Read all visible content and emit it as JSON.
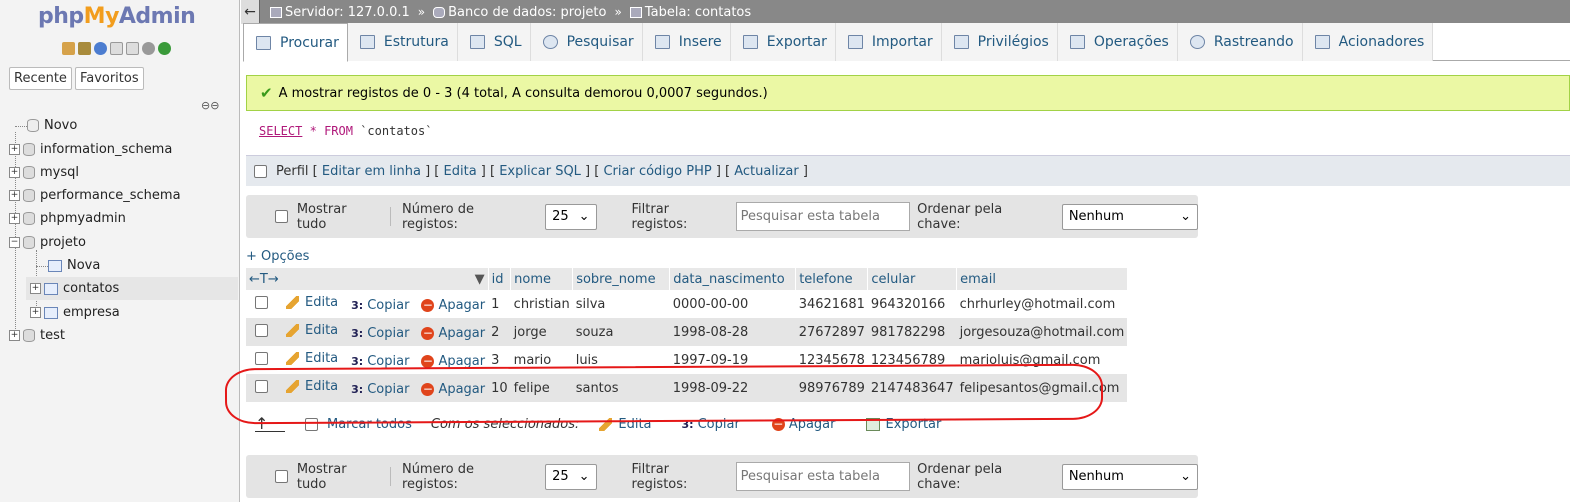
{
  "sidebar": {
    "logo": {
      "php": "php",
      "my": "My",
      "admin": "Admin"
    },
    "tabs": [
      "Recente",
      "Favoritos"
    ],
    "tree": [
      {
        "label": "Novo"
      },
      {
        "label": "information_schema"
      },
      {
        "label": "mysql"
      },
      {
        "label": "performance_schema"
      },
      {
        "label": "phpmyadmin"
      },
      {
        "label": "projeto"
      },
      {
        "label": "Nova"
      },
      {
        "label": "contatos"
      },
      {
        "label": "empresa"
      },
      {
        "label": "test"
      }
    ]
  },
  "breadcrumb": {
    "server": "Servidor: 127.0.0.1",
    "database": "Banco de dados: projeto",
    "table": "Tabela: contatos",
    "sep": "»",
    "back": "←"
  },
  "tabs": [
    "Procurar",
    "Estrutura",
    "SQL",
    "Pesquisar",
    "Insere",
    "Exportar",
    "Importar",
    "Privilégios",
    "Operações",
    "Rastreando",
    "Acionadores"
  ],
  "message": "A mostrar registos de 0 - 3 (4 total, A consulta demorou 0,0007 segundos.)",
  "sql": {
    "select": "SELECT",
    "star": "*",
    "from": "FROM",
    "table": "`contatos`"
  },
  "profile": {
    "label": "Perfil",
    "links": [
      "Editar em linha",
      "Edita",
      "Explicar SQL",
      "Criar código PHP",
      "Actualizar"
    ]
  },
  "nav": {
    "show_all": "Mostrar tudo",
    "rows_label": "Número de registos:",
    "rows_value": "25",
    "filter_label": "Filtrar registos:",
    "filter_placeholder": "Pesquisar esta tabela",
    "sort_label": "Ordenar pela chave:",
    "sort_value": "Nenhum"
  },
  "options": "+ Opções",
  "table": {
    "arrows": "←T→",
    "columns": [
      "id",
      "nome",
      "sobre_nome",
      "data_nascimento",
      "telefone",
      "celular",
      "email"
    ],
    "row_actions": {
      "edit": "Edita",
      "copy": "Copiar",
      "delete": "Apagar"
    },
    "rows": [
      [
        "1",
        "christian",
        "silva",
        "0000-00-00",
        "34621681",
        "964320166",
        "chrhurley@hotmail.com"
      ],
      [
        "2",
        "jorge",
        "souza",
        "1998-08-28",
        "27672897",
        "981782298",
        "jorgesouza@hotmail.com"
      ],
      [
        "3",
        "mario",
        "luis",
        "1997-09-19",
        "12345678",
        "123456789",
        "marioluis@gmail.com"
      ],
      [
        "10",
        "felipe",
        "santos",
        "1998-09-22",
        "98976789",
        "2147483647",
        "felipesantos@gmail.com"
      ]
    ]
  },
  "bulk": {
    "mark_all": "Marcar todos",
    "with_selected": "Com os seleccionados:",
    "edit": "Edita",
    "copy": "Copiar",
    "delete": "Apagar",
    "export": "Exportar"
  },
  "colors": {
    "link": "#235a81",
    "success_bg": "#ebf8a4",
    "annotation": "#e51818"
  }
}
